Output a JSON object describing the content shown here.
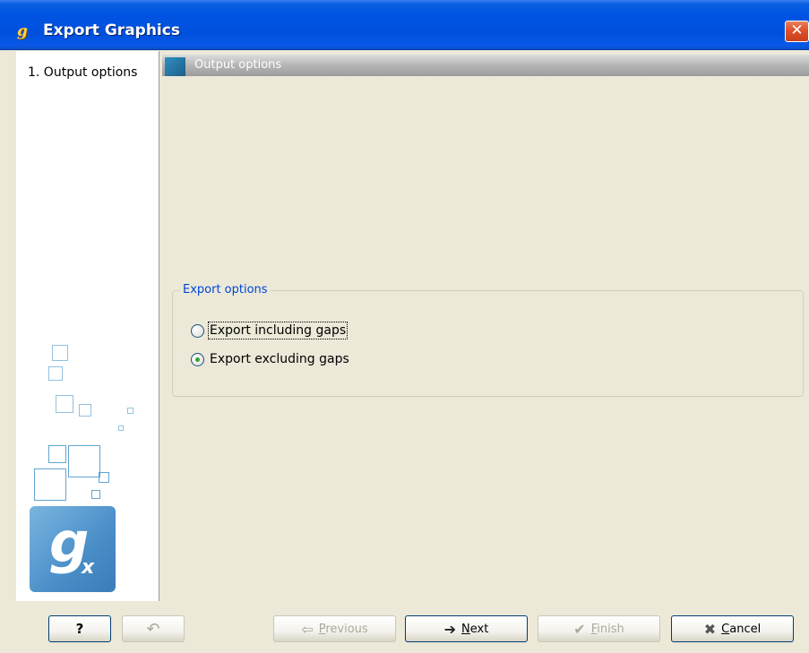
{
  "window": {
    "title": "Export Graphics",
    "app_icon": "g",
    "close_symbol": "✕"
  },
  "wizard": {
    "steps": [
      {
        "label": "1.  Output options"
      }
    ]
  },
  "logo": {
    "g": "g",
    "x": "x"
  },
  "section": {
    "title": "Output options"
  },
  "export_options": {
    "legend": "Export options",
    "options": [
      {
        "label": "Export including gaps",
        "selected": false
      },
      {
        "label": "Export excluding gaps",
        "selected": true
      }
    ]
  },
  "buttons": {
    "help": "?",
    "restore_icon": "↶",
    "previous_first": "P",
    "previous_rest": "revious",
    "next_first": "N",
    "next_rest": "ext",
    "finish_first": "F",
    "finish_rest": "inish",
    "cancel_first": "C",
    "cancel_rest": "ancel"
  },
  "colors": {
    "titlebar": "#0053e2",
    "legend_text": "#0046d5",
    "radio_dot": "#2fa72f"
  }
}
